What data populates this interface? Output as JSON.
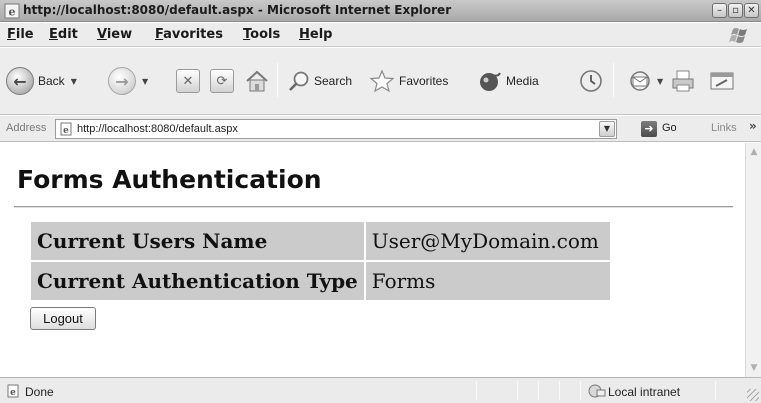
{
  "window": {
    "title": "http://localhost:8080/default.aspx - Microsoft Internet Explorer",
    "controls": [
      "minimize",
      "maximize",
      "close"
    ]
  },
  "menu": {
    "items": [
      "File",
      "Edit",
      "View",
      "Favorites",
      "Tools",
      "Help"
    ]
  },
  "toolbar": {
    "back_label": "Back",
    "search_label": "Search",
    "favorites_label": "Favorites",
    "media_label": "Media",
    "icons": [
      "back-icon",
      "forward-icon",
      "stop-icon",
      "refresh-icon",
      "home-icon",
      "search-icon",
      "favorites-star-icon",
      "media-icon",
      "history-icon",
      "mail-icon",
      "print-icon",
      "edit-icon"
    ]
  },
  "address": {
    "label": "Address",
    "url": "http://localhost:8080/default.aspx",
    "go_label": "Go",
    "links_label": "Links",
    "links_chevron": "»"
  },
  "page": {
    "heading": "Forms Authentication",
    "rows": [
      {
        "label": "Current Users Name",
        "value": "User@MyDomain.com"
      },
      {
        "label": "Current Authentication Type",
        "value": "Forms"
      }
    ],
    "logout_label": "Logout"
  },
  "status": {
    "text": "Done",
    "zone": "Local intranet"
  },
  "colors": {
    "table_cell_bg": "#cbcbcb",
    "chrome_bg": "#ececec",
    "title_bar": "#b8b8b8"
  }
}
